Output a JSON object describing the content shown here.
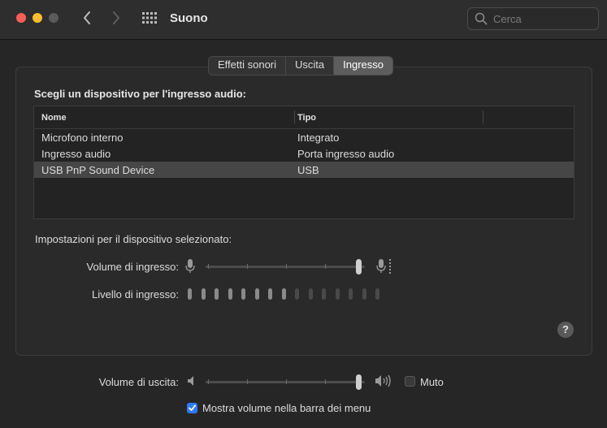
{
  "window": {
    "title": "Suono"
  },
  "search": {
    "placeholder": "Cerca"
  },
  "tabs": [
    {
      "label": "Effetti sonori",
      "active": false
    },
    {
      "label": "Uscita",
      "active": false
    },
    {
      "label": "Ingresso",
      "active": true
    }
  ],
  "device_section": {
    "title": "Scegli un dispositivo per l'ingresso audio:",
    "columns": [
      "Nome",
      "Tipo"
    ],
    "rows": [
      {
        "name": "Microfono interno",
        "type": "Integrato",
        "selected": false
      },
      {
        "name": "Ingresso audio",
        "type": "Porta ingresso audio",
        "selected": false
      },
      {
        "name": "USB PnP Sound Device",
        "type": "USB",
        "selected": true
      }
    ]
  },
  "settings": {
    "title": "Impostazioni per il dispositivo selezionato:",
    "input_volume_label": "Volume di ingresso:",
    "input_volume": 0.98,
    "input_level_label": "Livello di ingresso:",
    "input_level_bars_total": 15,
    "input_level_bars_lit": 8
  },
  "output": {
    "volume_label": "Volume di uscita:",
    "volume": 0.98,
    "mute_label": "Muto",
    "mute_checked": false,
    "show_in_menubar_label": "Mostra volume nella barra dei menu",
    "show_in_menubar_checked": true
  },
  "help": {
    "label": "?"
  },
  "colors": {
    "accent": "#2f7cf6",
    "selection": "#464646",
    "background": "#262626"
  }
}
